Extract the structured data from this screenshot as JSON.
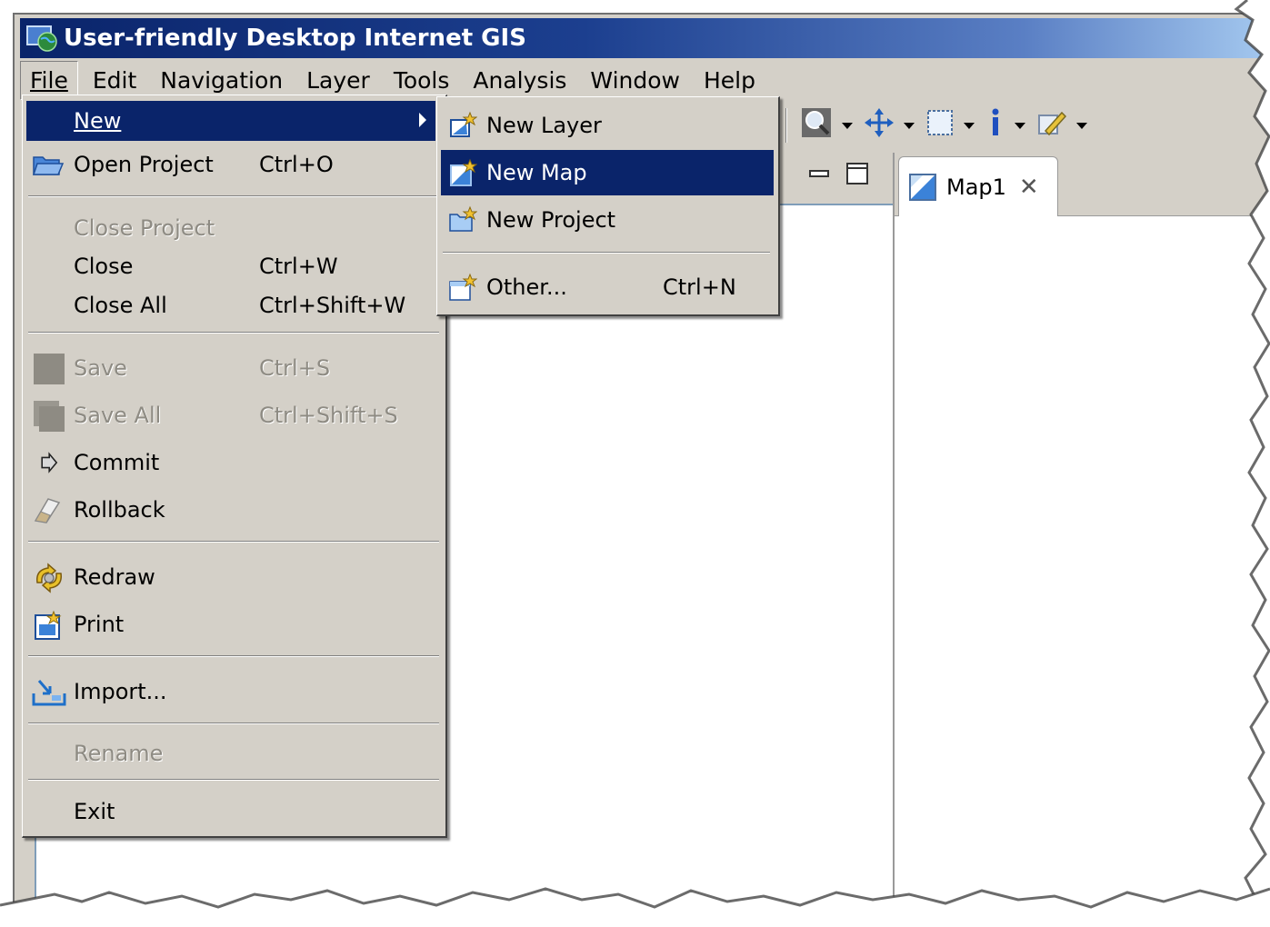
{
  "window": {
    "title": "User-friendly Desktop Internet GIS"
  },
  "menubar": {
    "items": [
      {
        "label": "File",
        "open": true
      },
      {
        "label": "Edit"
      },
      {
        "label": "Navigation"
      },
      {
        "label": "Layer"
      },
      {
        "label": "Tools"
      },
      {
        "label": "Analysis"
      },
      {
        "label": "Window"
      },
      {
        "label": "Help"
      }
    ]
  },
  "file_menu": {
    "new": {
      "label": "New"
    },
    "open_project": {
      "label": "Open Project",
      "shortcut": "Ctrl+O"
    },
    "close_project": {
      "label": "Close Project"
    },
    "close": {
      "label": "Close",
      "shortcut": "Ctrl+W"
    },
    "close_all": {
      "label": "Close All",
      "shortcut": "Ctrl+Shift+W"
    },
    "save": {
      "label": "Save",
      "shortcut": "Ctrl+S"
    },
    "save_all": {
      "label": "Save All",
      "shortcut": "Ctrl+Shift+S"
    },
    "commit": {
      "label": "Commit"
    },
    "rollback": {
      "label": "Rollback"
    },
    "redraw": {
      "label": "Redraw"
    },
    "print": {
      "label": "Print"
    },
    "import": {
      "label": "Import..."
    },
    "rename": {
      "label": "Rename"
    },
    "exit": {
      "label": "Exit"
    }
  },
  "new_submenu": {
    "new_layer": {
      "label": "New Layer"
    },
    "new_map": {
      "label": "New Map"
    },
    "new_project": {
      "label": "New Project"
    },
    "other": {
      "label": "Other...",
      "shortcut": "Ctrl+N"
    }
  },
  "editor": {
    "tab_label": "Map1"
  },
  "colors": {
    "highlight": "#0a246a",
    "menu_bg": "#d4d0c8",
    "title_start": "#0a246a",
    "title_end": "#a6caf0"
  }
}
